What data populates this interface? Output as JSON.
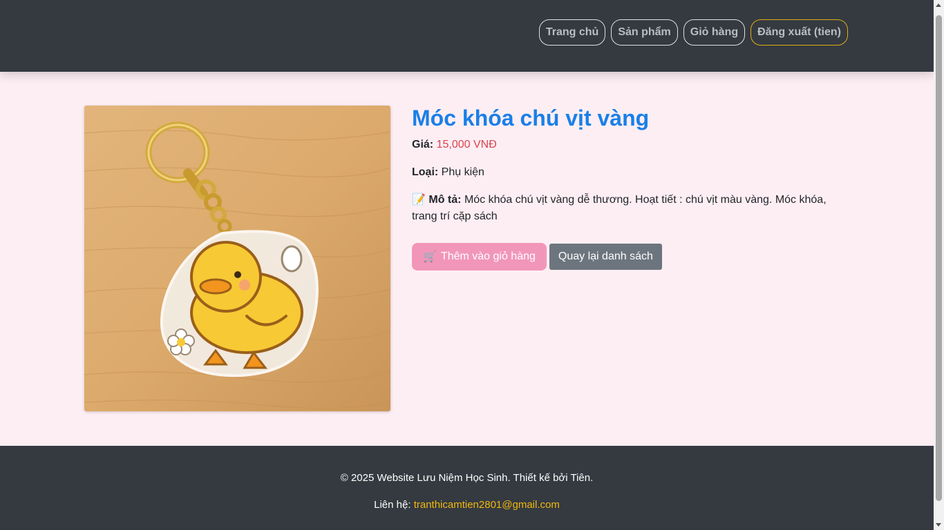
{
  "nav": {
    "home": "Trang chủ",
    "products": "Sản phẩm",
    "cart": "Giỏ hàng",
    "logout": "Đăng xuất (tien)"
  },
  "product": {
    "title": "Móc khóa chú vịt vàng",
    "price_label": "Giá:",
    "price_value": "15,000 VNĐ",
    "category_label": "Loại:",
    "category_value": "Phụ kiện",
    "desc_icon": "📝",
    "desc_label": "Mô tả:",
    "desc_value": "Móc khóa chú vịt vàng dễ thương. Hoạt tiết : chú vịt màu vàng. Móc khóa, trang trí cặp sách",
    "image_icon": "duck-keychain-image"
  },
  "actions": {
    "add_icon": "🛒",
    "add_to_cart": "Thêm vào giỏ hàng",
    "back": "Quay lại danh sách"
  },
  "footer": {
    "copyright": "© 2025 Website Lưu Niệm Học Sinh. Thiết kế bởi Tiên.",
    "contact_label": "Liên hệ:",
    "email": "tranthicamtien2801@gmail.com"
  },
  "colors": {
    "header_bg": "#343a40",
    "page_bg": "#fdeef3",
    "title": "#1a7fe8",
    "price": "#d9434f",
    "add_button": "#f296b9",
    "back_button": "#6c757d",
    "accent": "#f2b70f"
  }
}
